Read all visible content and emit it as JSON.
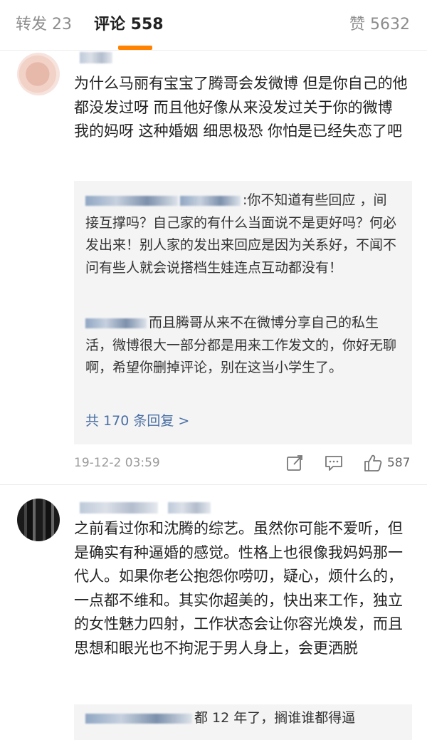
{
  "tabs": {
    "repost": "转发 23",
    "comment": "评论 558",
    "like": "赞 5632"
  },
  "comments": [
    {
      "text": "为什么马丽有宝宝了腾哥会发微博 但是你自己的他都没发过呀 而且他好像从来没发过关于你的微博 我的妈呀 这种婚姻 细思极恐 你怕是已经失恋了吧",
      "replies": [
        {
          "text": ":你不知道有些回应 ，间接互撑吗？自己家的有什么当面说不是更好吗？何必发出来！别人家的发出来回应是因为关系好，不闻不问有些人就会说搭档生娃连点互动都没有！"
        },
        {
          "text": "而且腾哥从来不在微博分享自己的私生活，微博很大一部分都是用来工作发文的，你好无聊啊，希望你删掉评论，别在这当小学生了。"
        }
      ],
      "more_replies": "共 170 条回复 >",
      "time": "19-12-2 03:59",
      "likes": "587"
    },
    {
      "text": "之前看过你和沈腾的综艺。虽然你可能不爱听，但是确实有种逼婚的感觉。性格上也很像我妈妈那一代人。如果你老公抱怨你唠叨，疑心，烦什么的，一点都不维和。其实你超美的，快出来工作，独立的女性魅力四射，工作状态会让你容光焕发，而且思想和眼光也不拘泥于男人身上，会更洒脱",
      "replies": [
        {
          "text": "都 12 年了，搁谁谁都得逼"
        }
      ]
    }
  ],
  "icons": {
    "share": "share-icon",
    "reply": "comment-icon",
    "like": "thumbs-up-icon"
  },
  "colors": {
    "accent": "#ff8200",
    "link": "#4a6fa5"
  }
}
